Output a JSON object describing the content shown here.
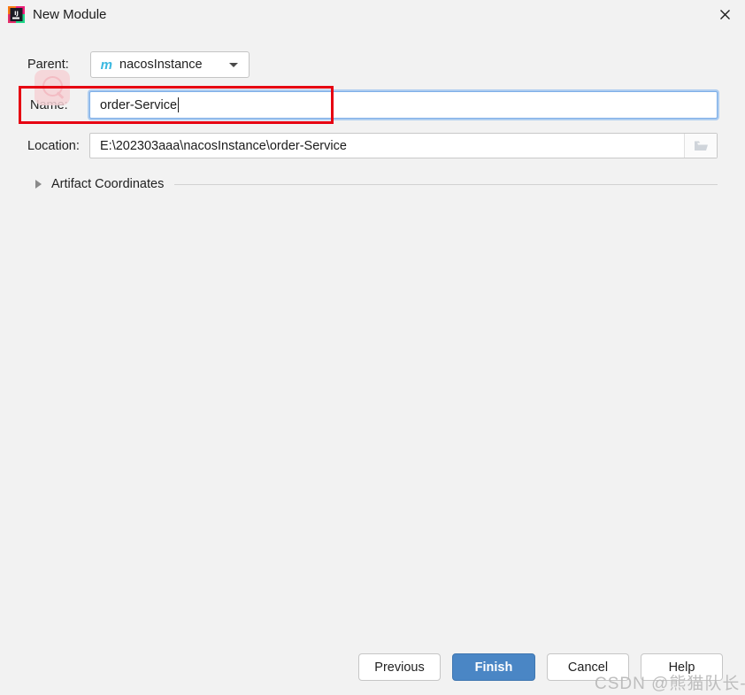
{
  "window": {
    "title": "New Module",
    "app_icon": "intellij-idea-icon",
    "close_icon": "close-icon"
  },
  "form": {
    "parent": {
      "label": "Parent:",
      "value": "nacosInstance",
      "icon": "maven-module-icon",
      "dropdown_icon": "chevron-down-icon"
    },
    "name": {
      "label": "Name:",
      "value": "order-Service",
      "placeholder": ""
    },
    "location": {
      "label": "Location:",
      "value": "E:\\202303aaa\\nacosInstance\\order-Service",
      "placeholder": "",
      "browse_icon": "folder-open-icon"
    },
    "artifact_coordinates": {
      "label": "Artifact Coordinates",
      "expanded": false,
      "expander_icon": "chevron-right-icon"
    }
  },
  "buttons": {
    "previous": "Previous",
    "finish": "Finish",
    "cancel": "Cancel",
    "help": "Help"
  },
  "annotations": {
    "highlight_color": "#e60012",
    "watermark": "CSDN @熊猫队长-"
  },
  "colors": {
    "background": "#f2f2f2",
    "primary_button": "#4a86c5",
    "focus_ring": "#aecdf0",
    "maven_icon": "#3ab8e0"
  }
}
